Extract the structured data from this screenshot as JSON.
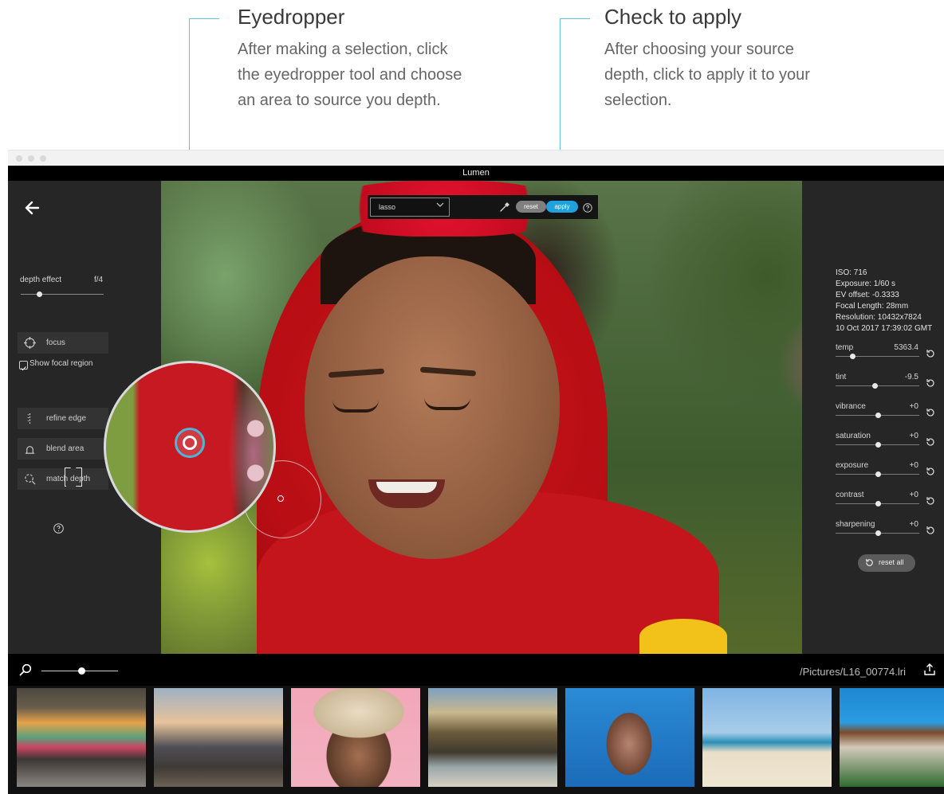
{
  "callouts": {
    "eyedropper": {
      "title": "Eyedropper",
      "lines": [
        "After making a selection, click",
        "the eyedropper tool and choose",
        "an area to source you depth."
      ]
    },
    "apply": {
      "title": "Check to apply",
      "lines": [
        "After choosing your source",
        "depth, click to apply it to your",
        "selection."
      ]
    }
  },
  "window": {
    "title": "Lumen"
  },
  "left_panel": {
    "depth_label": "depth effect",
    "depth_value": "f/4",
    "depth_level": 0.22,
    "focus_button": "focus",
    "show_focal_region": "Show focal region",
    "show_focal_region_checked": true,
    "refine_edge": "refine edge",
    "blend_area": "blend area",
    "match_depth": "match depth"
  },
  "toolbar": {
    "select_value": "lasso",
    "reset_label": "reset",
    "apply_label": "apply"
  },
  "metadata": [
    "ISO: 716",
    "Exposure: 1/60 s",
    "EV offset: -0.3333",
    "Focal Length: 28mm",
    "Resolution: 10432x7824",
    "10 Oct 2017 17:39:02 GMT"
  ],
  "adjustments": [
    {
      "label": "temp",
      "value": "5363.4",
      "level": 0.2
    },
    {
      "label": "tint",
      "value": "-9.5",
      "level": 0.47
    },
    {
      "label": "vibrance",
      "value": "+0",
      "level": 0.5
    },
    {
      "label": "saturation",
      "value": "+0",
      "level": 0.5
    },
    {
      "label": "exposure",
      "value": "+0",
      "level": 0.5
    },
    {
      "label": "contrast",
      "value": "+0",
      "level": 0.5
    },
    {
      "label": "sharpening",
      "value": "+0",
      "level": 0.5
    }
  ],
  "reset_all_label": "reset all",
  "filmbar": {
    "zoom_level": 0.52,
    "path": "/Pictures/L16_00774.lri"
  },
  "colors": {
    "accent": "#1ea1dc",
    "callout_line": "#5cc6e0"
  }
}
